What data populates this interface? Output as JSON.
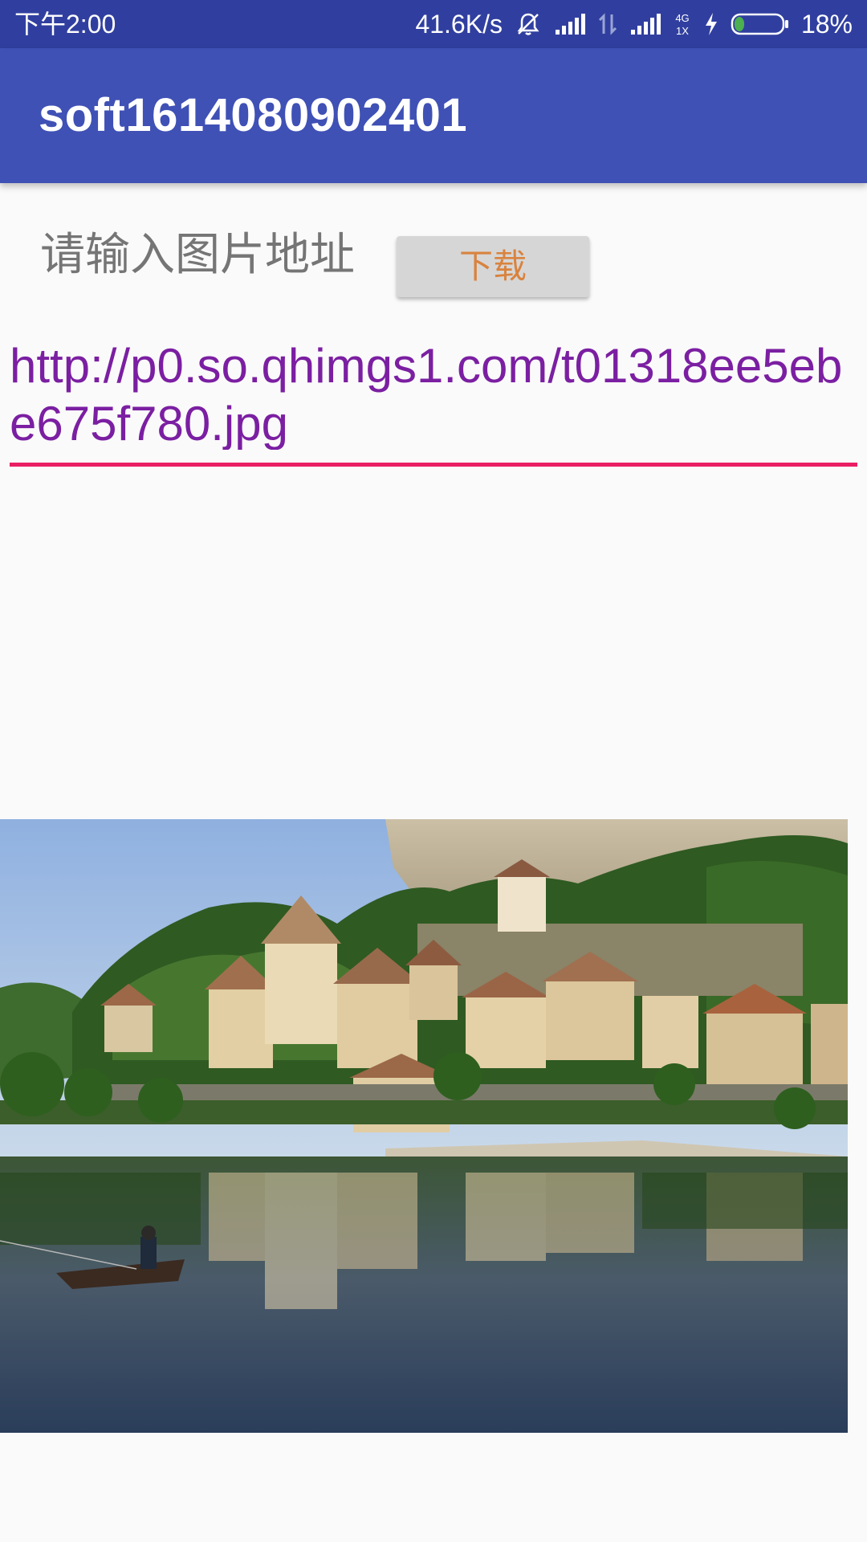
{
  "status_bar": {
    "time": "下午2:00",
    "speed": "41.6K/s",
    "network": "4G\n1X",
    "battery_percent": "18%",
    "icons": [
      "mute-icon",
      "signal-icon",
      "data-arrows-icon",
      "signal-4g-icon",
      "charging-icon",
      "battery-icon"
    ]
  },
  "app_bar": {
    "title": "soft1614080902401"
  },
  "form": {
    "prompt_label": "请输入图片地址",
    "download_label": "下载",
    "url_value": "http://p0.so.qhimgs1.com/t01318ee5ebe675f780.jpg"
  },
  "colors": {
    "status_bar": "#303f9f",
    "app_bar": "#3f51b5",
    "url_text": "#7b1fa2",
    "url_underline": "#e91e63",
    "button_text": "#d9833e"
  }
}
